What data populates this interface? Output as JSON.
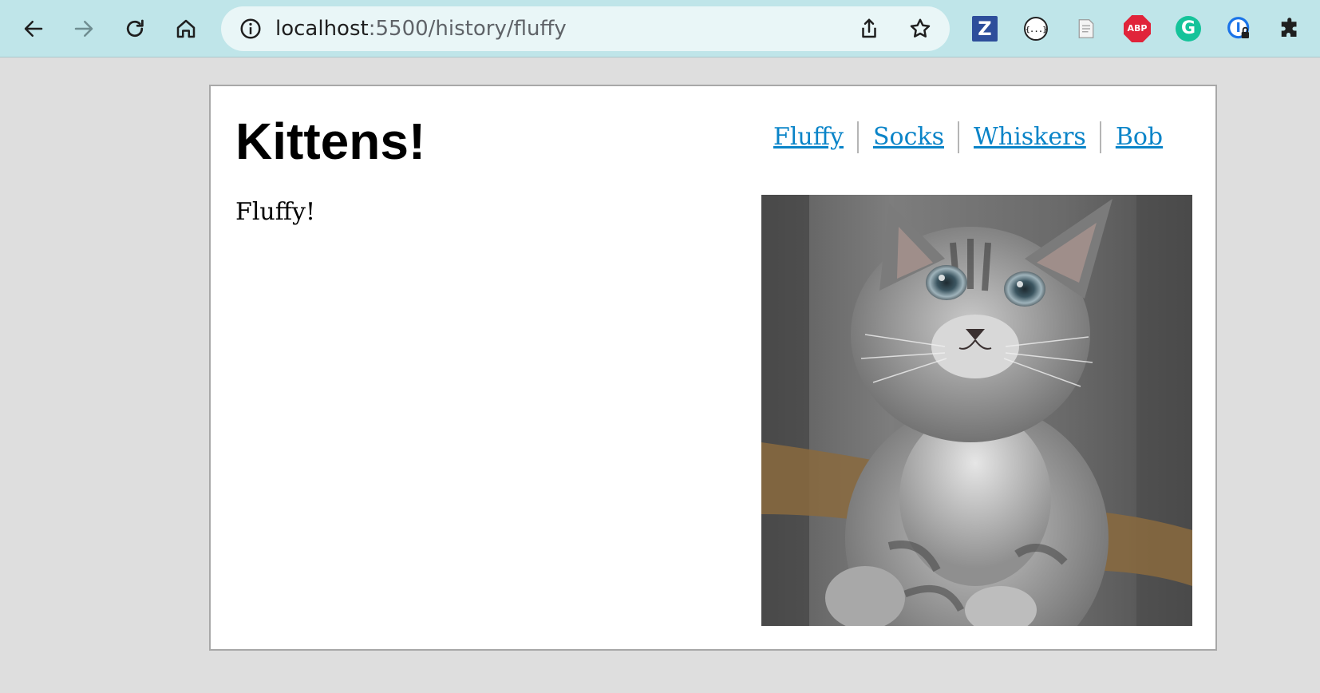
{
  "browser": {
    "url_host": "localhost",
    "url_path": ":5500/history/fluffy",
    "extensions": {
      "zotero_label": "Z",
      "json_label": "{...}",
      "abp_label": "ABP",
      "grammarly_label": "G"
    }
  },
  "page": {
    "title": "Kittens!",
    "nav": [
      "Fluffy",
      "Socks",
      "Whiskers",
      "Bob"
    ],
    "content_text": "Fluffy!"
  },
  "colors": {
    "toolbar_bg": "#bfe5e9",
    "link": "#0a84c8",
    "page_bg": "#dedede"
  }
}
